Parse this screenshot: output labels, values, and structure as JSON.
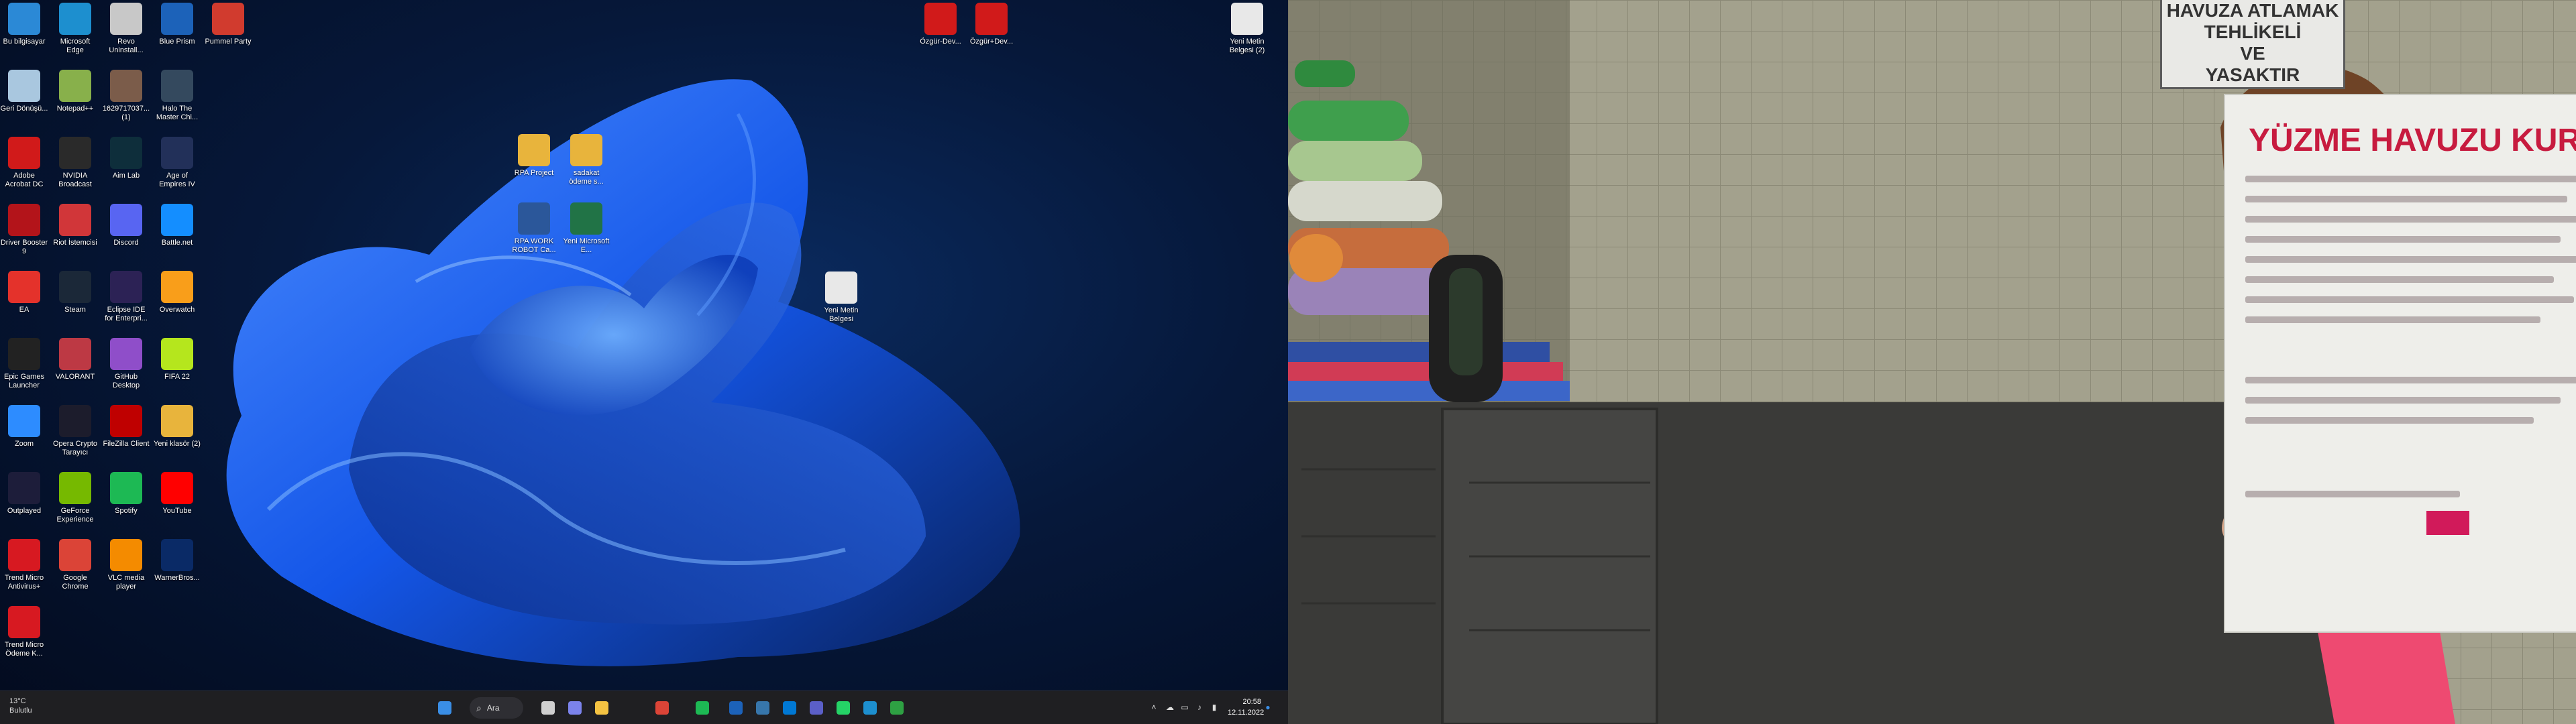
{
  "desktop_icons": [
    {
      "label": "Bu bilgisayar",
      "icon": "this-pc-icon",
      "color": "#2b89d6"
    },
    {
      "label": "Microsoft Edge",
      "icon": "edge-icon",
      "color": "#1d8fcf"
    },
    {
      "label": "Revo Uninstall...",
      "icon": "revo-uninstaller-icon",
      "color": "#c8c8c8"
    },
    {
      "label": "Blue Prism",
      "icon": "blue-prism-icon",
      "color": "#1c62b9"
    },
    {
      "label": "Pummel Party",
      "icon": "pummel-party-icon",
      "color": "#d13b2e"
    },
    {
      "label": "Geri Dönüşü...",
      "icon": "recycle-bin-icon",
      "color": "#a9c7df"
    },
    {
      "label": "Notepad++",
      "icon": "notepad-plus-icon",
      "color": "#88b04b"
    },
    {
      "label": "1629717037... (1)",
      "icon": "photo-icon",
      "color": "#7b5c4a"
    },
    {
      "label": "Halo The Master Chi...",
      "icon": "halo-icon",
      "color": "#34495e"
    },
    {
      "label": "Adobe Acrobat DC",
      "icon": "acrobat-icon",
      "color": "#d11a1a"
    },
    {
      "label": "NVIDIA Broadcast",
      "icon": "nvidia-broadcast-icon",
      "color": "#2a2a2a"
    },
    {
      "label": "Aim Lab",
      "icon": "aim-lab-icon",
      "color": "#0e2e3b"
    },
    {
      "label": "Age of Empires IV",
      "icon": "age-of-empires-icon",
      "color": "#223059"
    },
    {
      "label": "Driver Booster 9",
      "icon": "driver-booster-icon",
      "color": "#b3141a"
    },
    {
      "label": "Riot İstemcisi",
      "icon": "riot-icon",
      "color": "#d13639"
    },
    {
      "label": "Discord",
      "icon": "discord-icon",
      "color": "#5865f2"
    },
    {
      "label": "Battle.net",
      "icon": "battlenet-icon",
      "color": "#148eff"
    },
    {
      "label": "EA",
      "icon": "ea-icon",
      "color": "#e4322b"
    },
    {
      "label": "Steam",
      "icon": "steam-icon",
      "color": "#1b2838"
    },
    {
      "label": "Eclipse IDE for Enterpri...",
      "icon": "eclipse-icon",
      "color": "#2c2255"
    },
    {
      "label": "Overwatch",
      "icon": "overwatch-icon",
      "color": "#f99e1a"
    },
    {
      "label": "Epic Games Launcher",
      "icon": "epic-games-icon",
      "color": "#222222"
    },
    {
      "label": "VALORANT",
      "icon": "valorant-icon",
      "color": "#bd3944"
    },
    {
      "label": "GitHub Desktop",
      "icon": "github-desktop-icon",
      "color": "#8f4ec9"
    },
    {
      "label": "FIFA 22",
      "icon": "fifa-icon",
      "color": "#b5e61d"
    },
    {
      "label": "Zoom",
      "icon": "zoom-icon",
      "color": "#2d8cff"
    },
    {
      "label": "Opera Crypto Tarayıcı",
      "icon": "opera-icon",
      "color": "#1c1c2c"
    },
    {
      "label": "FileZilla Client",
      "icon": "filezilla-icon",
      "color": "#bf0000"
    },
    {
      "label": "Yeni klasör (2)",
      "icon": "folder-icon",
      "color": "#e8b43c"
    },
    {
      "label": "Outplayed",
      "icon": "outplayed-icon",
      "color": "#1d1d3a"
    },
    {
      "label": "GeForce Experience",
      "icon": "geforce-icon",
      "color": "#76b900"
    },
    {
      "label": "Spotify",
      "icon": "spotify-icon",
      "color": "#1db954"
    },
    {
      "label": "YouTube",
      "icon": "youtube-icon",
      "color": "#ff0000"
    },
    {
      "label": "Trend Micro Antivirus+",
      "icon": "trend-micro-icon",
      "color": "#d71921"
    },
    {
      "label": "Google Chrome",
      "icon": "chrome-icon",
      "color": "#db4437"
    },
    {
      "label": "VLC media player",
      "icon": "vlc-icon",
      "color": "#f48b00"
    },
    {
      "label": "WarnerBros...",
      "icon": "warner-bros-icon",
      "color": "#0a2a66"
    },
    {
      "label": "Trend Micro Ödeme K...",
      "icon": "trend-micro-pay-icon",
      "color": "#d71921"
    }
  ],
  "floating_icons": [
    {
      "label": "RPA Project",
      "icon": "folder-icon",
      "color": "#e8b43c"
    },
    {
      "label": "sadakat ödeme s...",
      "icon": "folder-icon",
      "color": "#e8b43c"
    },
    {
      "label": "RPA WORK ROBOT Ca...",
      "icon": "word-doc-icon",
      "color": "#2b579a"
    },
    {
      "label": "Yeni Microsoft E...",
      "icon": "excel-doc-icon",
      "color": "#217346"
    },
    {
      "label": "Yeni Metin Belgesi",
      "icon": "text-doc-icon",
      "color": "#e8e8e8"
    },
    {
      "label": "Özgür-Dev...",
      "icon": "pdf-icon",
      "color": "#d11a1a"
    },
    {
      "label": "Özgür+Dev...",
      "icon": "pdf-icon",
      "color": "#d11a1a"
    },
    {
      "label": "Yeni Metin Belgesi (2)",
      "icon": "text-doc-icon",
      "color": "#e8e8e8"
    }
  ],
  "taskbar": {
    "weather_temp": "13°C",
    "weather_status": "Bulutlu",
    "search_label": "Ara",
    "time": "20:58",
    "date": "12.11.2022",
    "apps": [
      {
        "icon": "windows-start-icon",
        "color": "#3a8ee6"
      },
      {
        "icon": "task-view-icon",
        "color": "#cfcfcf"
      },
      {
        "icon": "chat-icon",
        "color": "#7b83eb"
      },
      {
        "icon": "file-explorer-icon",
        "color": "#f5c342"
      },
      {
        "icon": "chrome-icon",
        "color": "#db4437"
      },
      {
        "icon": "spotify-icon",
        "color": "#1db954"
      },
      {
        "icon": "blue-prism-icon",
        "color": "#1c62b9"
      },
      {
        "icon": "python-icon",
        "color": "#3776ab"
      },
      {
        "icon": "outlook-icon",
        "color": "#0078d4"
      },
      {
        "icon": "teams-icon",
        "color": "#5b5fc7"
      },
      {
        "icon": "whatsapp-icon",
        "color": "#25d366"
      },
      {
        "icon": "edge-icon",
        "color": "#1d8fcf"
      },
      {
        "icon": "notepad-icon",
        "color": "#2ea043"
      }
    ]
  },
  "video": {
    "sign_top_lines": [
      "HAVUZA ATLAMAK",
      "TEHLİKELİ",
      "VE",
      "YASAKTIR"
    ],
    "sign_title": "YÜZME HAVUZU KURALLARI"
  }
}
